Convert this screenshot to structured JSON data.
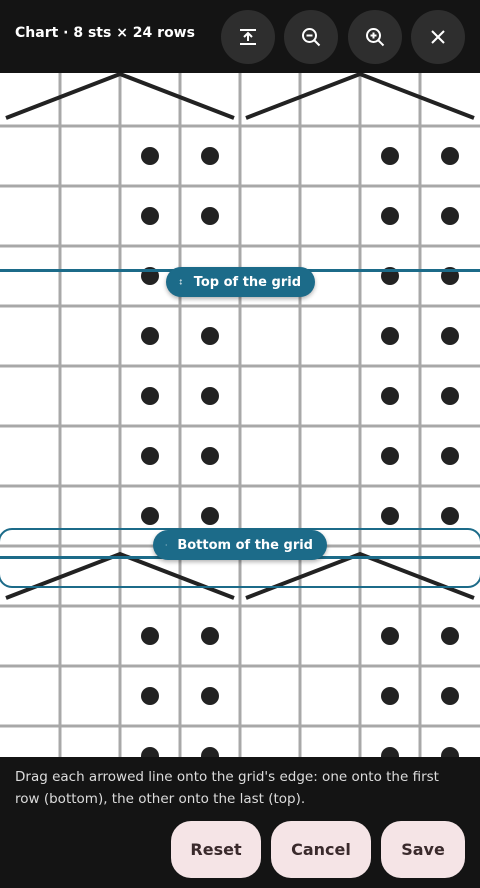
{
  "header": {
    "title": "Chart · 8 sts × 24 rows",
    "buttons": [
      {
        "name": "fit-height-button",
        "icon": "fit-height-icon"
      },
      {
        "name": "zoom-out-button",
        "icon": "zoom-out-icon"
      },
      {
        "name": "zoom-in-button",
        "icon": "zoom-in-icon"
      },
      {
        "name": "close-button",
        "icon": "close-icon"
      }
    ]
  },
  "chart": {
    "columns": 8,
    "stitch_pattern": [
      false,
      false,
      true,
      true,
      false,
      false,
      true,
      true
    ],
    "cable_rows": [
      0,
      8
    ],
    "colors": {
      "grid": "#a8a8a8",
      "symbol": "#222222",
      "handle": "#1c6b89"
    }
  },
  "handles": {
    "top_label": "Top of the grid",
    "bottom_label": "Bottom of the grid"
  },
  "footer": {
    "hint": "Drag each arrowed line onto the grid's edge: one onto the first row (bottom), the other onto the last (top).",
    "reset_label": "Reset",
    "cancel_label": "Cancel",
    "save_label": "Save"
  }
}
